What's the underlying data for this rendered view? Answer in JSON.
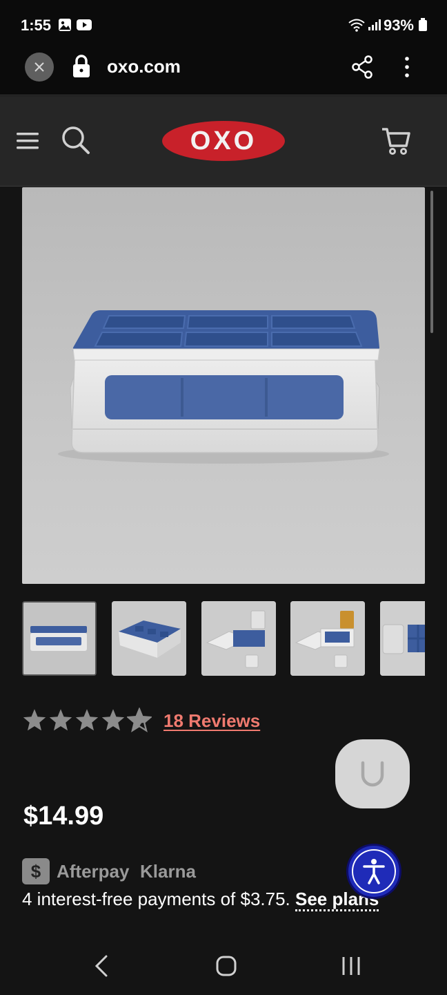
{
  "status_bar": {
    "time": "1:55",
    "battery": "93%"
  },
  "browser": {
    "url": "oxo.com"
  },
  "site": {
    "logo_text": "OXO",
    "brand_color": "#c8212a"
  },
  "product": {
    "rating": 4.5,
    "reviews_label": "18 Reviews",
    "price": "$14.99",
    "tray_color": "#3d5d9e",
    "thumbnails_count": 5,
    "active_thumbnail": 1
  },
  "payment": {
    "afterpay_label": "Afterpay",
    "klarna_label": "Klarna",
    "installments_text": "4 interest-free payments of $3.75. ",
    "see_plans_label": "See plans"
  },
  "accessibility": {
    "accent": "#1f2bb8"
  }
}
